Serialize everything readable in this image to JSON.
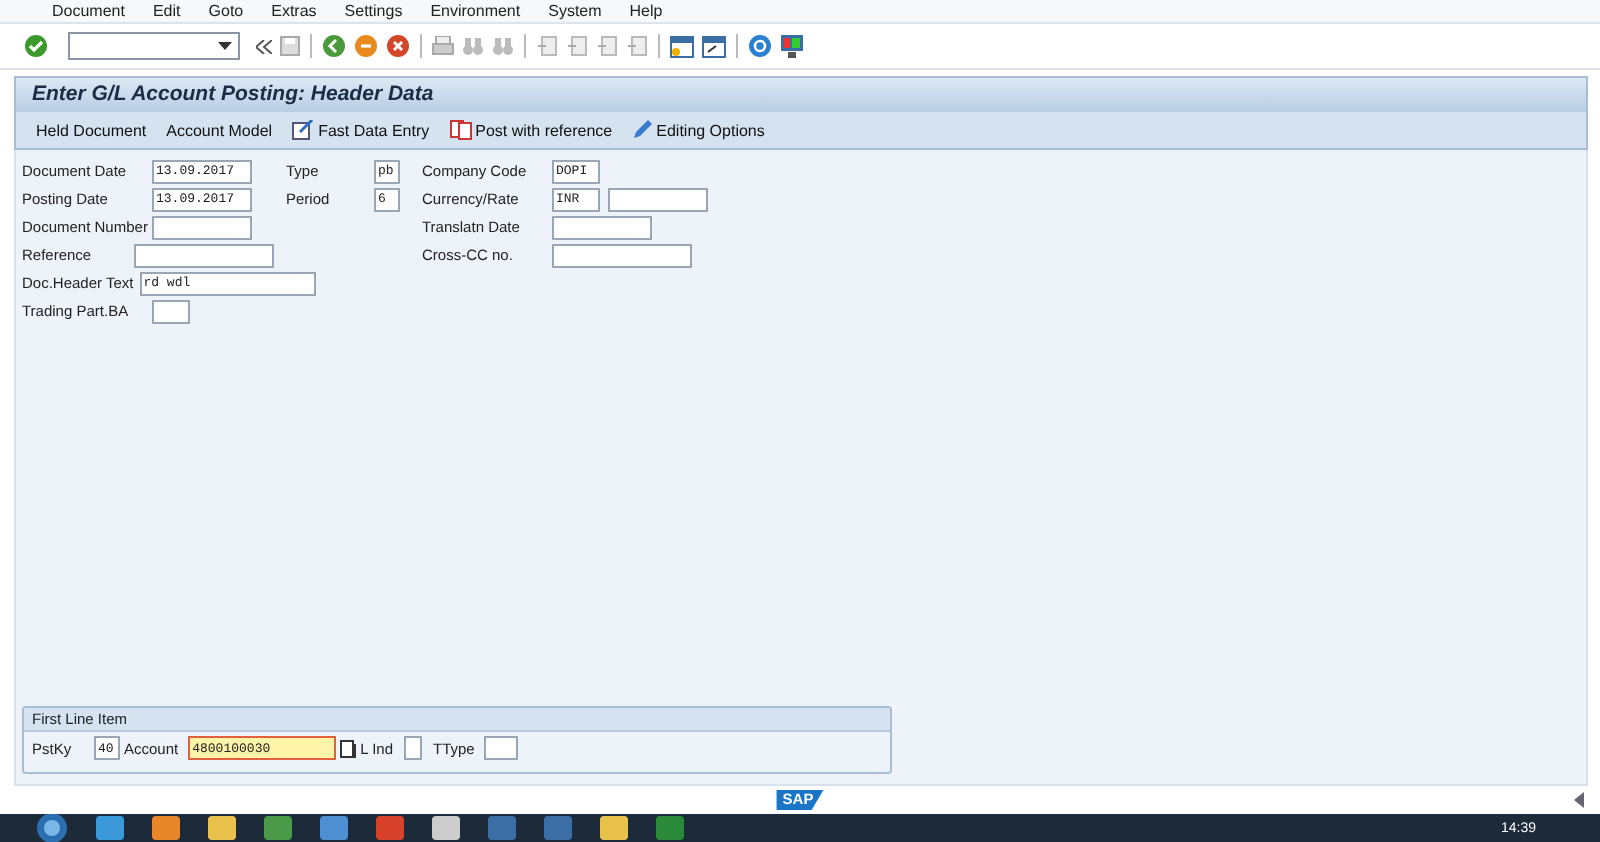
{
  "menu_bar": {
    "items": [
      "Document",
      "Edit",
      "Goto",
      "Extras",
      "Settings",
      "Environment",
      "System",
      "Help"
    ]
  },
  "title": "Enter G/L Account Posting: Header Data",
  "app_toolbar": [
    {
      "label": "Held Document"
    },
    {
      "label": "Account Model"
    },
    {
      "label": "Fast Data Entry"
    },
    {
      "label": "Post with reference"
    },
    {
      "label": "Editing Options"
    }
  ],
  "header_rows": [
    {
      "left": {
        "label": "Document Date",
        "value": "13.09.2017"
      },
      "middle": {
        "label": "Type",
        "value": "pb"
      },
      "right": {
        "label": "Company Code",
        "value": "DOPI"
      }
    },
    {
      "left": {
        "label": "Posting Date",
        "value": "13.09.2017"
      },
      "middle": {
        "label": "Period",
        "value": "6"
      },
      "right": {
        "label": "Currency/Rate",
        "value": "INR"
      }
    },
    {
      "left": {
        "label": "Document Number"
      },
      "right": {
        "label": "Translatn Date"
      }
    },
    {
      "left": {
        "label": "Reference"
      },
      "right": {
        "label": "Cross-CC no."
      }
    },
    {
      "left": {
        "label": "Doc.Header Text",
        "value": "rd wdl"
      }
    },
    {
      "left": {
        "label": "Trading Part.BA"
      }
    }
  ],
  "first_line_item": {
    "title": "First Line Item",
    "posting_key": {
      "label": "PstKy",
      "value": "40"
    },
    "account": {
      "label": "Account",
      "value": "4800100030",
      "focused": true
    },
    "l_ind": {
      "label": "L Ind"
    },
    "ttype": {
      "label": "TType"
    }
  },
  "footer": {
    "logo": "SAP"
  },
  "taskbar": {
    "clock": "14:39"
  }
}
